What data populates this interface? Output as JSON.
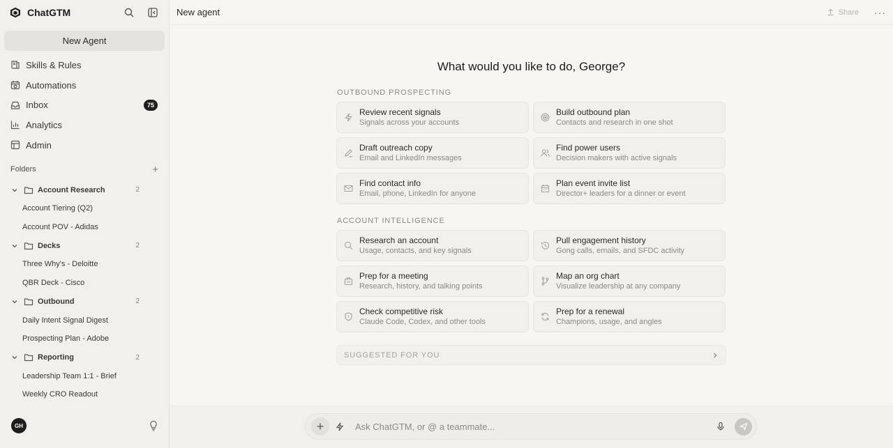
{
  "app": {
    "name": "ChatGTM"
  },
  "sidebar": {
    "new_agent_label": "New Agent",
    "nav": [
      {
        "label": "Skills & Rules",
        "icon": "book-icon"
      },
      {
        "label": "Automations",
        "icon": "calendar-clock-icon"
      },
      {
        "label": "Inbox",
        "icon": "inbox-icon",
        "badge": "75"
      },
      {
        "label": "Analytics",
        "icon": "bar-chart-icon"
      },
      {
        "label": "Admin",
        "icon": "table-icon"
      }
    ],
    "folders_title": "Folders",
    "folders": [
      {
        "name": "Account Research",
        "count": "2",
        "items": [
          "Account Tiering (Q2)",
          "Account POV - Adidas"
        ]
      },
      {
        "name": "Decks",
        "count": "2",
        "items": [
          "Three Why's - Deloitte",
          "QBR Deck - Cisco"
        ]
      },
      {
        "name": "Outbound",
        "count": "2",
        "items": [
          "Daily Intent Signal Digest",
          "Prospecting Plan - Adobe"
        ]
      },
      {
        "name": "Reporting",
        "count": "2",
        "items": [
          "Leadership Team 1:1 - Brief",
          "Weekly CRO Readout"
        ]
      }
    ],
    "user_initials": "GH"
  },
  "header": {
    "title": "New agent",
    "share_label": "Share",
    "more_label": "···"
  },
  "main": {
    "greeting": "What would you like to do, George?",
    "sections": [
      {
        "label": "OUTBOUND PROSPECTING",
        "cards": [
          {
            "title": "Review recent signals",
            "subtitle": "Signals across your accounts",
            "icon": "bolt-icon"
          },
          {
            "title": "Build outbound plan",
            "subtitle": "Contacts and research in one shot",
            "icon": "target-icon"
          },
          {
            "title": "Draft outreach copy",
            "subtitle": "Email and LinkedIn messages",
            "icon": "pencil-icon"
          },
          {
            "title": "Find power users",
            "subtitle": "Decision makers with active signals",
            "icon": "users-icon"
          },
          {
            "title": "Find contact info",
            "subtitle": "Email, phone, LinkedIn for anyone",
            "icon": "mail-icon"
          },
          {
            "title": "Plan event invite list",
            "subtitle": "Director+ leaders for a dinner or event",
            "icon": "calendar-icon"
          }
        ]
      },
      {
        "label": "ACCOUNT INTELLIGENCE",
        "cards": [
          {
            "title": "Research an account",
            "subtitle": "Usage, contacts, and key signals",
            "icon": "search-icon"
          },
          {
            "title": "Pull engagement history",
            "subtitle": "Gong calls, emails, and SFDC activity",
            "icon": "history-icon"
          },
          {
            "title": "Prep for a meeting",
            "subtitle": "Research, history, and talking points",
            "icon": "briefcase-icon"
          },
          {
            "title": "Map an org chart",
            "subtitle": "Visualize leadership at any company",
            "icon": "branch-icon"
          },
          {
            "title": "Check competitive risk",
            "subtitle": "Claude Code, Codex, and other tools",
            "icon": "shield-icon"
          },
          {
            "title": "Prep for a renewal",
            "subtitle": "Champions, usage, and angles",
            "icon": "refresh-icon"
          }
        ]
      }
    ],
    "suggested_label": "SUGGESTED FOR YOU"
  },
  "composer": {
    "placeholder": "Ask ChatGTM, or @ a teammate..."
  }
}
